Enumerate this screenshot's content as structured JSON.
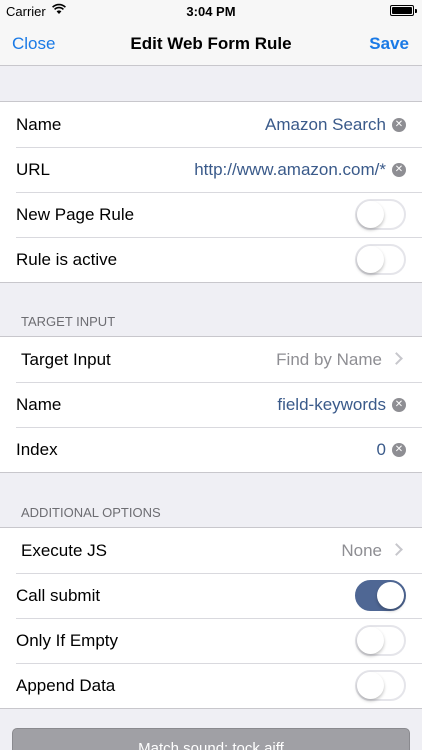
{
  "status_bar": {
    "carrier": "Carrier",
    "time": "3:04 PM"
  },
  "nav": {
    "left": "Close",
    "title": "Edit Web Form Rule",
    "right": "Save"
  },
  "colors": {
    "accent": "#1a7ae6",
    "value_text": "#3a5a8a",
    "toggle_on": "#4f6794"
  },
  "section1": {
    "name_label": "Name",
    "name_value": "Amazon Search",
    "url_label": "URL",
    "url_value": "http://www.amazon.com/*",
    "new_page_label": "New Page Rule",
    "new_page_on": false,
    "active_label": "Rule is active",
    "active_on": false
  },
  "target": {
    "header": "TARGET INPUT",
    "target_label": "Target Input",
    "target_value": "Find by Name",
    "name_label": "Name",
    "name_value": "field-keywords",
    "index_label": "Index",
    "index_value": "0"
  },
  "options": {
    "header": "ADDITIONAL OPTIONS",
    "execute_label": "Execute JS",
    "execute_value": "None",
    "submit_label": "Call submit",
    "submit_on": true,
    "empty_label": "Only If Empty",
    "empty_on": false,
    "append_label": "Append Data",
    "append_on": false
  },
  "bottom_button": "Match sound: tock.aiff"
}
